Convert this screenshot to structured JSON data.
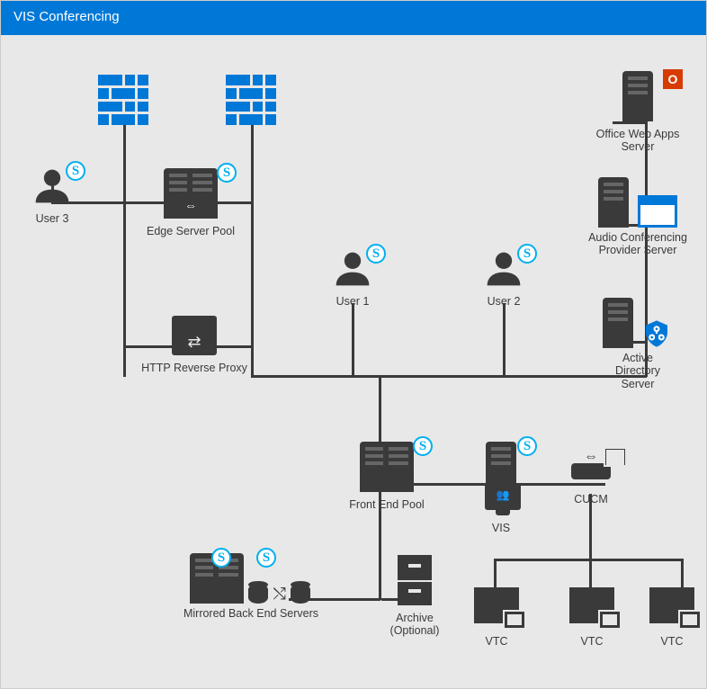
{
  "header": {
    "title": "VIS Conferencing"
  },
  "nodes": {
    "user3": "User 3",
    "edge_pool": "Edge Server Pool",
    "http_proxy": "HTTP Reverse Proxy",
    "user1": "User 1",
    "user2": "User 2",
    "owa": "Office Web Apps\nServer",
    "acp": "Audio Conferencing\nProvider Server",
    "ad": "Active\nDirectory\nServer",
    "front_end": "Front End Pool",
    "vis": "VIS",
    "cucm": "CUCM",
    "mirrored": "Mirrored Back End Servers",
    "archive": "Archive\n(Optional)",
    "vtc": "VTC"
  },
  "badges": {
    "skype": "S",
    "office": "O"
  }
}
